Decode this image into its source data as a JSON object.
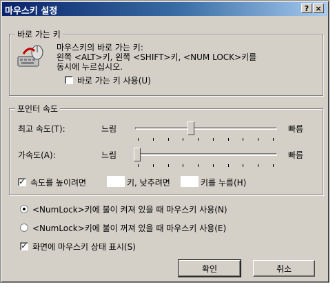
{
  "window": {
    "title": "마우스키 설정",
    "help_glyph": "?",
    "close_glyph": "×"
  },
  "shortcut": {
    "legend": "바로 가는 키",
    "line1": "마우스키의 바로 가는 키:",
    "line2": "왼쪽 <ALT>키, 왼쪽 <SHIFT>키, <NUM LOCK>키를",
    "line3": "동시에 누르십시오.",
    "use_label": "바로 가는 키 사용(U)",
    "use_checked": false,
    "icon": "mouse-keyboard-icon"
  },
  "pointer_speed": {
    "legend": "포인터 속도",
    "top_speed": {
      "label": "최고 속도(T):",
      "slow": "느림",
      "fast": "빠름",
      "level": 0.4
    },
    "acceleration": {
      "label": "가속도(A):",
      "slow": "느림",
      "fast": "빠름",
      "level": 0.0
    },
    "hold_label_a": "속도를 높이려면",
    "hold_label_b": "키, 낮추려면",
    "hold_label_c": "키를 누름(H)",
    "hold_checked": true,
    "check_mark": "✓"
  },
  "options": {
    "radio_on": "<NumLock>키에 불이 켜져 있을 때 마우스키 사용(N)",
    "radio_off": "<NumLock>키에 불이 꺼져 있을 때 마우스키 사용(E)",
    "selected": "on",
    "show_status": "화면에 마우스키 상태 표시(S)",
    "show_status_checked": true
  },
  "buttons": {
    "ok": "확인",
    "cancel": "취소"
  }
}
